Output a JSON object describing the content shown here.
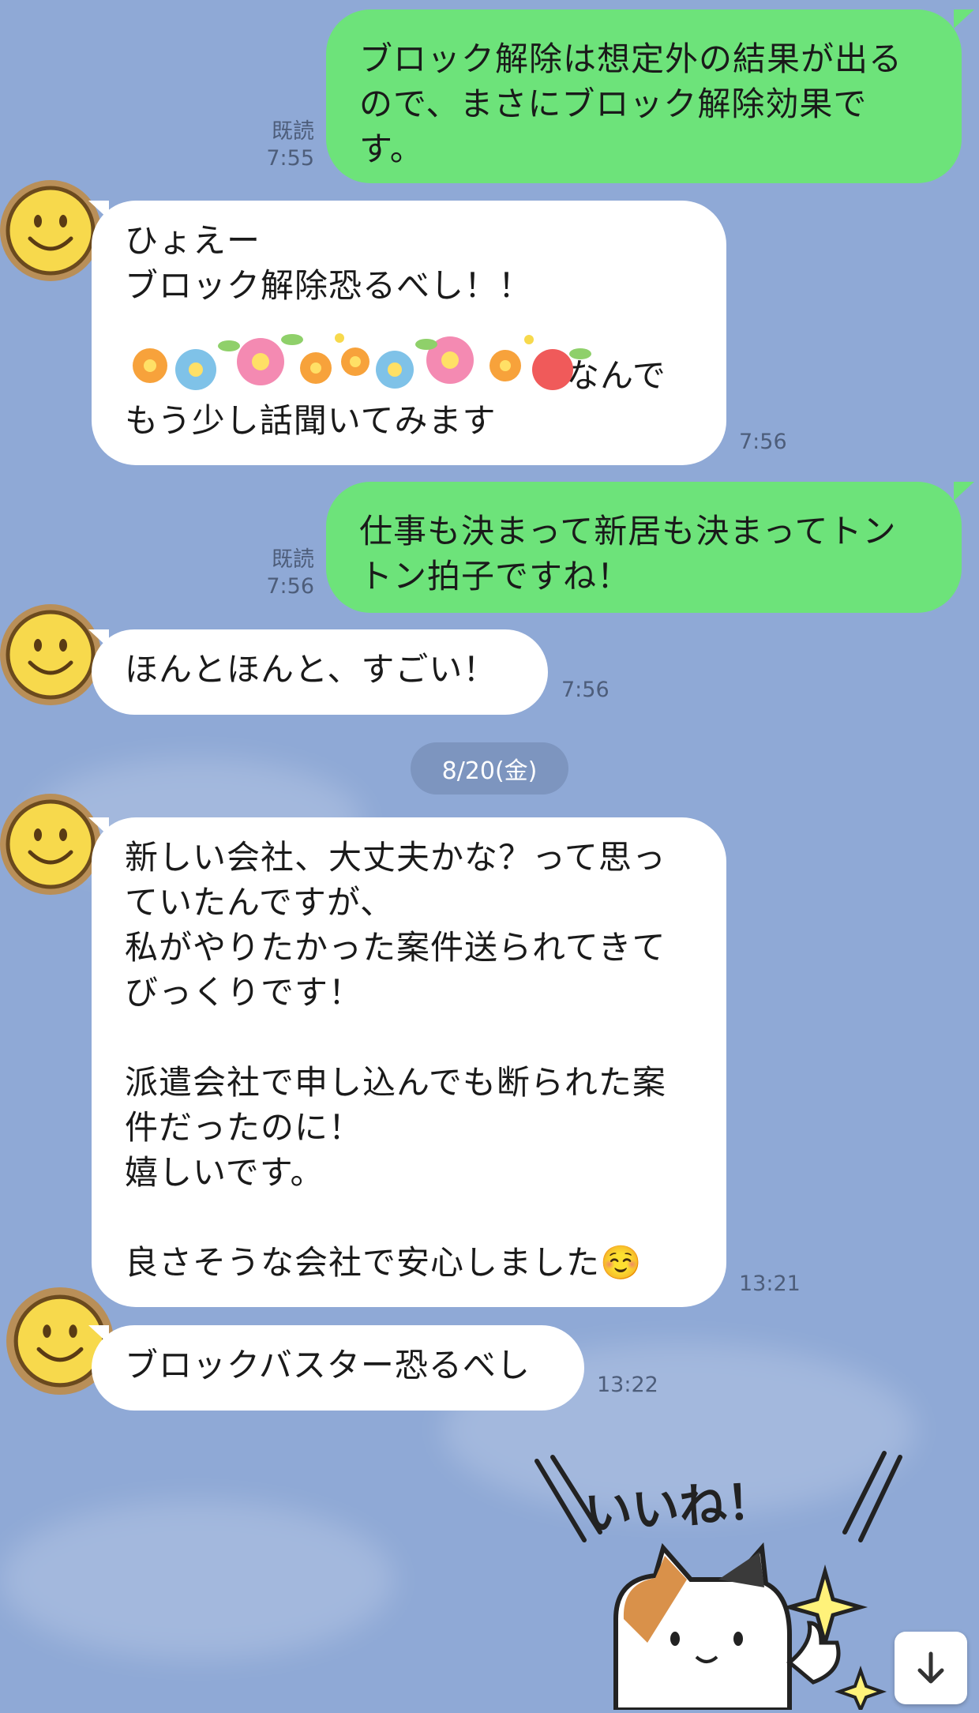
{
  "messages": [
    {
      "id": "m1",
      "sender": "me",
      "text": "ブロック解除は想定外の結果が出る\nので、まさにブロック解除効果で\nす。",
      "read": "既読",
      "time": "7:55"
    },
    {
      "id": "m2",
      "sender": "them",
      "text": "ひょえー\nブロック解除恐るべし！！\n\n　　　　　　　　　　　　　なんで\nもう少し話聞いてみます",
      "time": "7:56"
    },
    {
      "id": "m3",
      "sender": "me",
      "text": "仕事も決まって新居も決まってトン\nトン拍子ですね！",
      "read": "既読",
      "time": "7:56"
    },
    {
      "id": "m4",
      "sender": "them",
      "text": "ほんとほんと、すごい！",
      "time": "7:56"
    },
    {
      "id": "m5",
      "sender": "them",
      "text": "新しい会社、大丈夫かな？って思っ\nていたんですが、\n私がやりたかった案件送られてきて\nびっくりです！\n\n派遣会社で申し込んでも断られた案\n件だったのに！\n嬉しいです。\n\n良さそうな会社で安心しました☺️",
      "time": "13:21"
    },
    {
      "id": "m6",
      "sender": "them",
      "text": "ブロックバスター恐るべし",
      "time": "13:22"
    }
  ],
  "date_separator": "8/20(金)",
  "sticker": {
    "text": "いいね！",
    "icon": "calico-cat-thumbs-up-sticker"
  },
  "scroll_down_icon": "arrow-down-icon",
  "avatar_icon": "smiley-face-icon",
  "redaction_icon": "flower-decoration-icon",
  "colors": {
    "background": "#8fa9d6",
    "my_bubble": "#6de37a",
    "their_bubble": "#ffffff",
    "date_pill": "#7d95bf"
  }
}
